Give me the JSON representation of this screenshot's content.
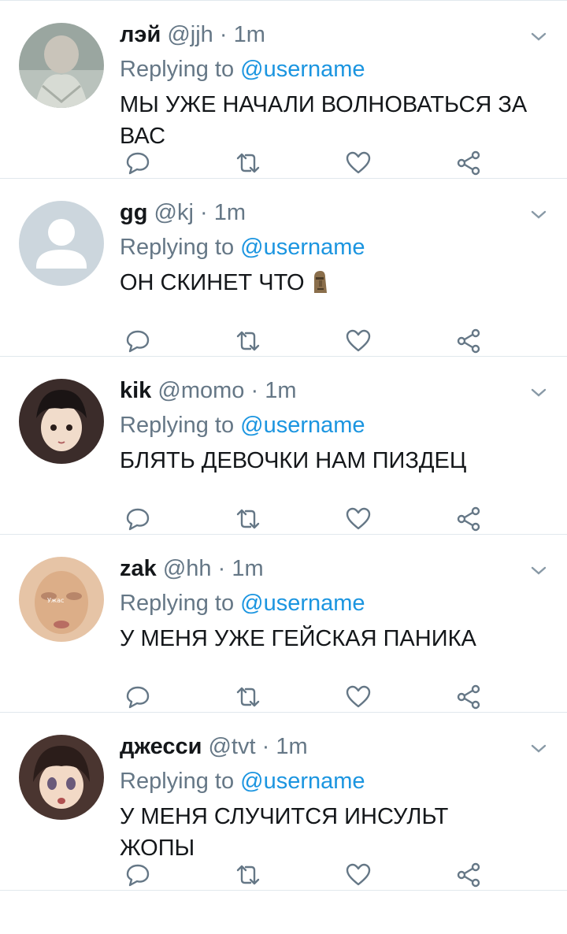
{
  "colors": {
    "accent": "#1b95e0",
    "muted": "#657786",
    "text": "#14171a",
    "divider": "#e1e8ed"
  },
  "icons": [
    "reply-icon",
    "retweet-icon",
    "like-icon",
    "share-icon",
    "chevron-down-icon",
    "moai-emoji"
  ],
  "tweets": [
    {
      "name": "лэй",
      "handle": "@jjh",
      "sep": "·",
      "time": "1m",
      "replying": "Replying to",
      "mention": "@username",
      "text": "МЫ УЖЕ НАЧАЛИ ВОЛНОВАТЬСЯ ЗА ВАС"
    },
    {
      "name": "gg",
      "handle": "@kj",
      "sep": "·",
      "time": "1m",
      "replying": "Replying to",
      "mention": "@username",
      "text": "ОН СКИНЕТ ЧТО"
    },
    {
      "name": "kik",
      "handle": "@momo",
      "sep": "·",
      "time": "1m",
      "replying": "Replying to",
      "mention": "@username",
      "text": "БЛЯТЬ ДЕВОЧКИ НАМ ПИЗДЕЦ"
    },
    {
      "name": "zak",
      "handle": "@hh",
      "sep": "·",
      "time": "1m",
      "replying": "Replying to",
      "mention": "@username",
      "text": "У МЕНЯ УЖЕ ГЕЙСКАЯ ПАНИКА",
      "avatar_caption": "Ужас"
    },
    {
      "name": "джесси",
      "handle": "@tvt",
      "sep": "·",
      "time": "1m",
      "replying": "Replying to",
      "mention": "@username",
      "text": "У МЕНЯ СЛУЧИТСЯ ИНСУЛЬТ ЖОПЫ"
    }
  ]
}
